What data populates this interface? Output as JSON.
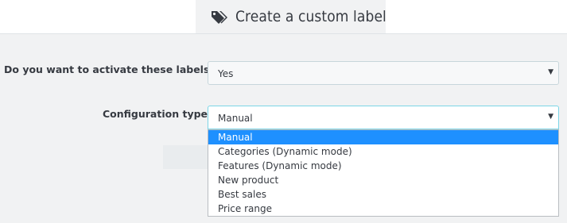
{
  "header": {
    "title": "Create a custom label",
    "icon": "tags-icon"
  },
  "form": {
    "activate": {
      "label": "Do you want to activate these labels ?",
      "value": "Yes"
    },
    "config_type": {
      "label": "Configuration type",
      "value": "Manual",
      "options": [
        "Manual",
        "Categories (Dynamic mode)",
        "Features (Dynamic mode)",
        "New product",
        "Best sales",
        "Price range"
      ],
      "highlighted_option": "Manual"
    }
  },
  "colors": {
    "panel_bg": "#f1f2f3",
    "highlight": "#1e90ff",
    "focus_border": "#7cd5e7"
  }
}
